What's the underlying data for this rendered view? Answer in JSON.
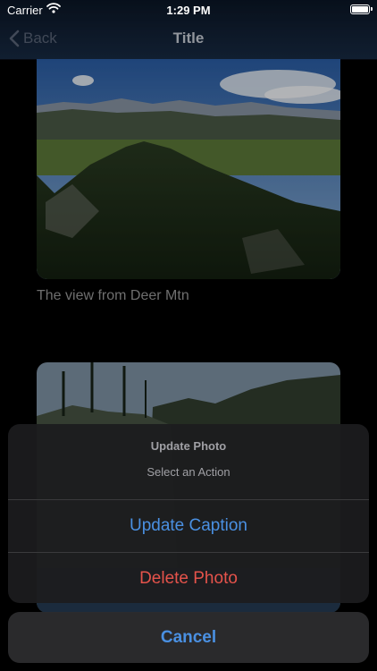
{
  "status_bar": {
    "carrier": "Carrier",
    "time": "1:29 PM"
  },
  "nav": {
    "back_label": "Back",
    "title": "Title"
  },
  "photos": [
    {
      "caption": "The view from Deer Mtn"
    },
    {
      "caption": ""
    }
  ],
  "action_sheet": {
    "title": "Update Photo",
    "message": "Select an Action",
    "actions": [
      {
        "label": "Update Caption",
        "style": "default",
        "color": "#4a90e2"
      },
      {
        "label": "Delete Photo",
        "style": "destructive",
        "color": "#e5534b"
      }
    ],
    "cancel_label": "Cancel"
  }
}
